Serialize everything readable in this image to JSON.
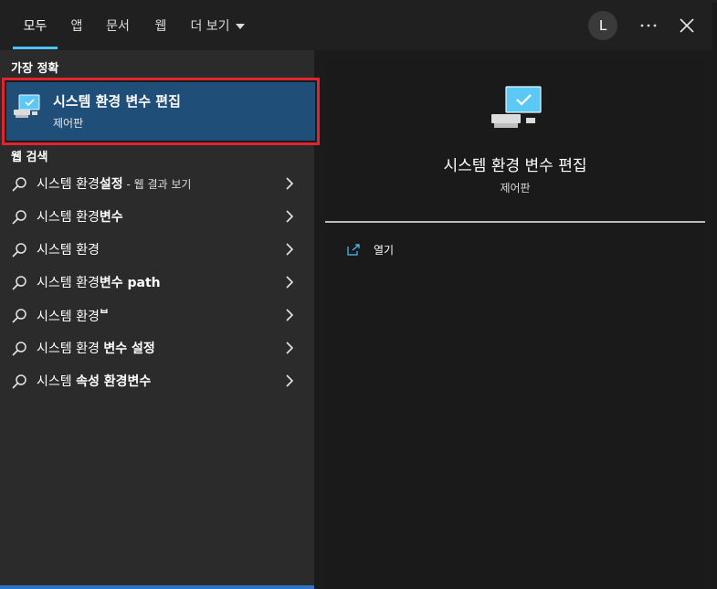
{
  "header": {
    "tabs": [
      {
        "label": "모두",
        "active": true
      },
      {
        "label": "앱"
      },
      {
        "label": "문서"
      },
      {
        "label": "웹"
      },
      {
        "label": "더 보기"
      }
    ],
    "avatar_initial": "L"
  },
  "best_match": {
    "section_title": "가장 정확",
    "title": "시스템 환경 변수 편집",
    "subtitle": "제어판",
    "icon": "monitor-settings-icon"
  },
  "web_search": {
    "section_title": "웹 검색",
    "items": [
      {
        "normal": "시스템 환경",
        "bold": "설정",
        "suffix": " - 웹 결과 보기"
      },
      {
        "normal": "시스템 환경",
        "bold": "변수",
        "suffix": ""
      },
      {
        "normal": "시스템 환경",
        "bold": "",
        "suffix": ""
      },
      {
        "normal": "시스템 환경",
        "bold": "변수 path",
        "suffix": ""
      },
      {
        "normal": "시스템 환경",
        "bold": "ᄇ",
        "suffix": ""
      },
      {
        "normal": "시스템 환경 ",
        "bold": "변수 설정",
        "suffix": ""
      },
      {
        "normal": "시스템 ",
        "bold": "속성 환경변수",
        "suffix": ""
      }
    ]
  },
  "detail": {
    "title": "시스템 환경 변수 편집",
    "subtitle": "제어판",
    "actions": [
      {
        "label": "열기",
        "icon": "open-icon"
      }
    ]
  },
  "colors": {
    "accent": "#4cc2ff",
    "highlight": "#1f4e79",
    "outline": "#e0252f"
  }
}
